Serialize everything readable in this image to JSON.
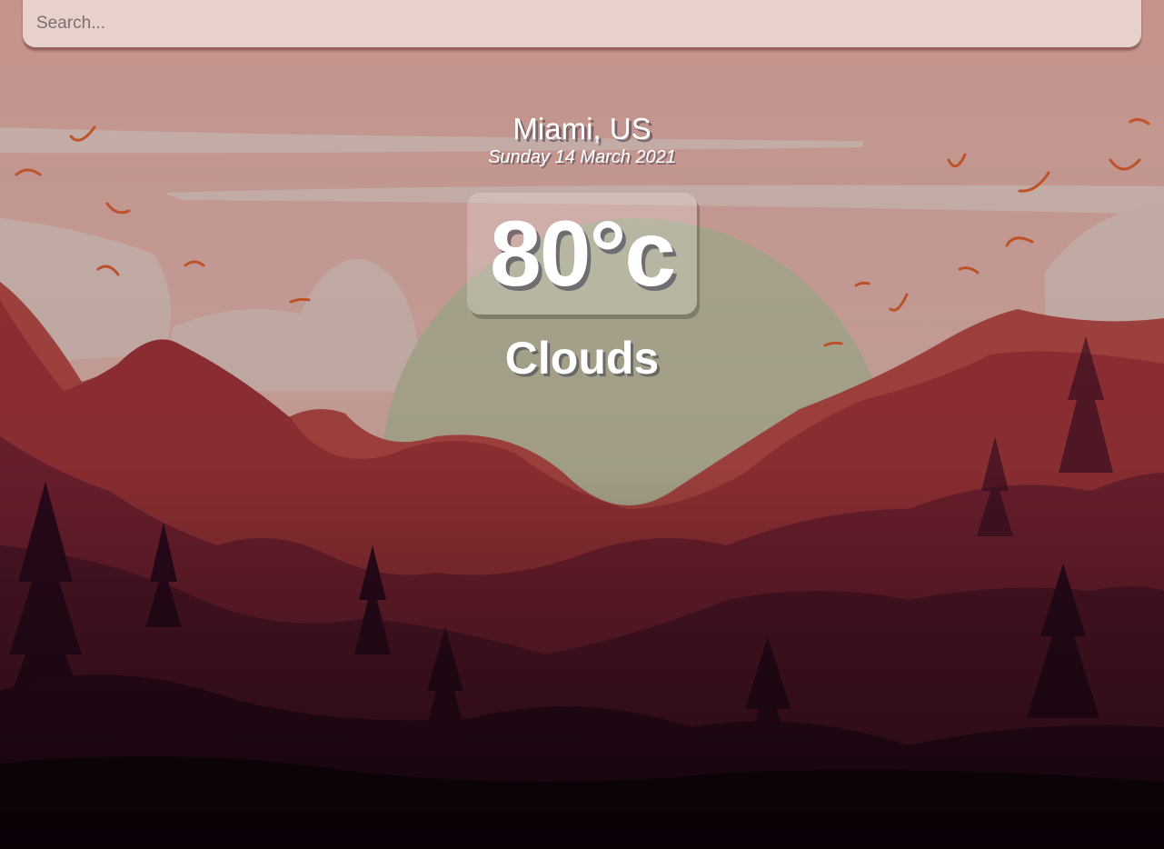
{
  "search": {
    "placeholder": "Search...",
    "value": ""
  },
  "location": {
    "city": "Miami, US",
    "date": "Sunday 14 March 2021"
  },
  "weather": {
    "temperature": "80°c",
    "condition": "Clouds"
  },
  "background": {
    "theme": "mountain-sunset-illustration",
    "colors": {
      "sky": "#c99a90",
      "sun": "#a8a68e",
      "mountain_red": "#8c2a2e",
      "forest_dark": "#2a0b1c"
    }
  }
}
